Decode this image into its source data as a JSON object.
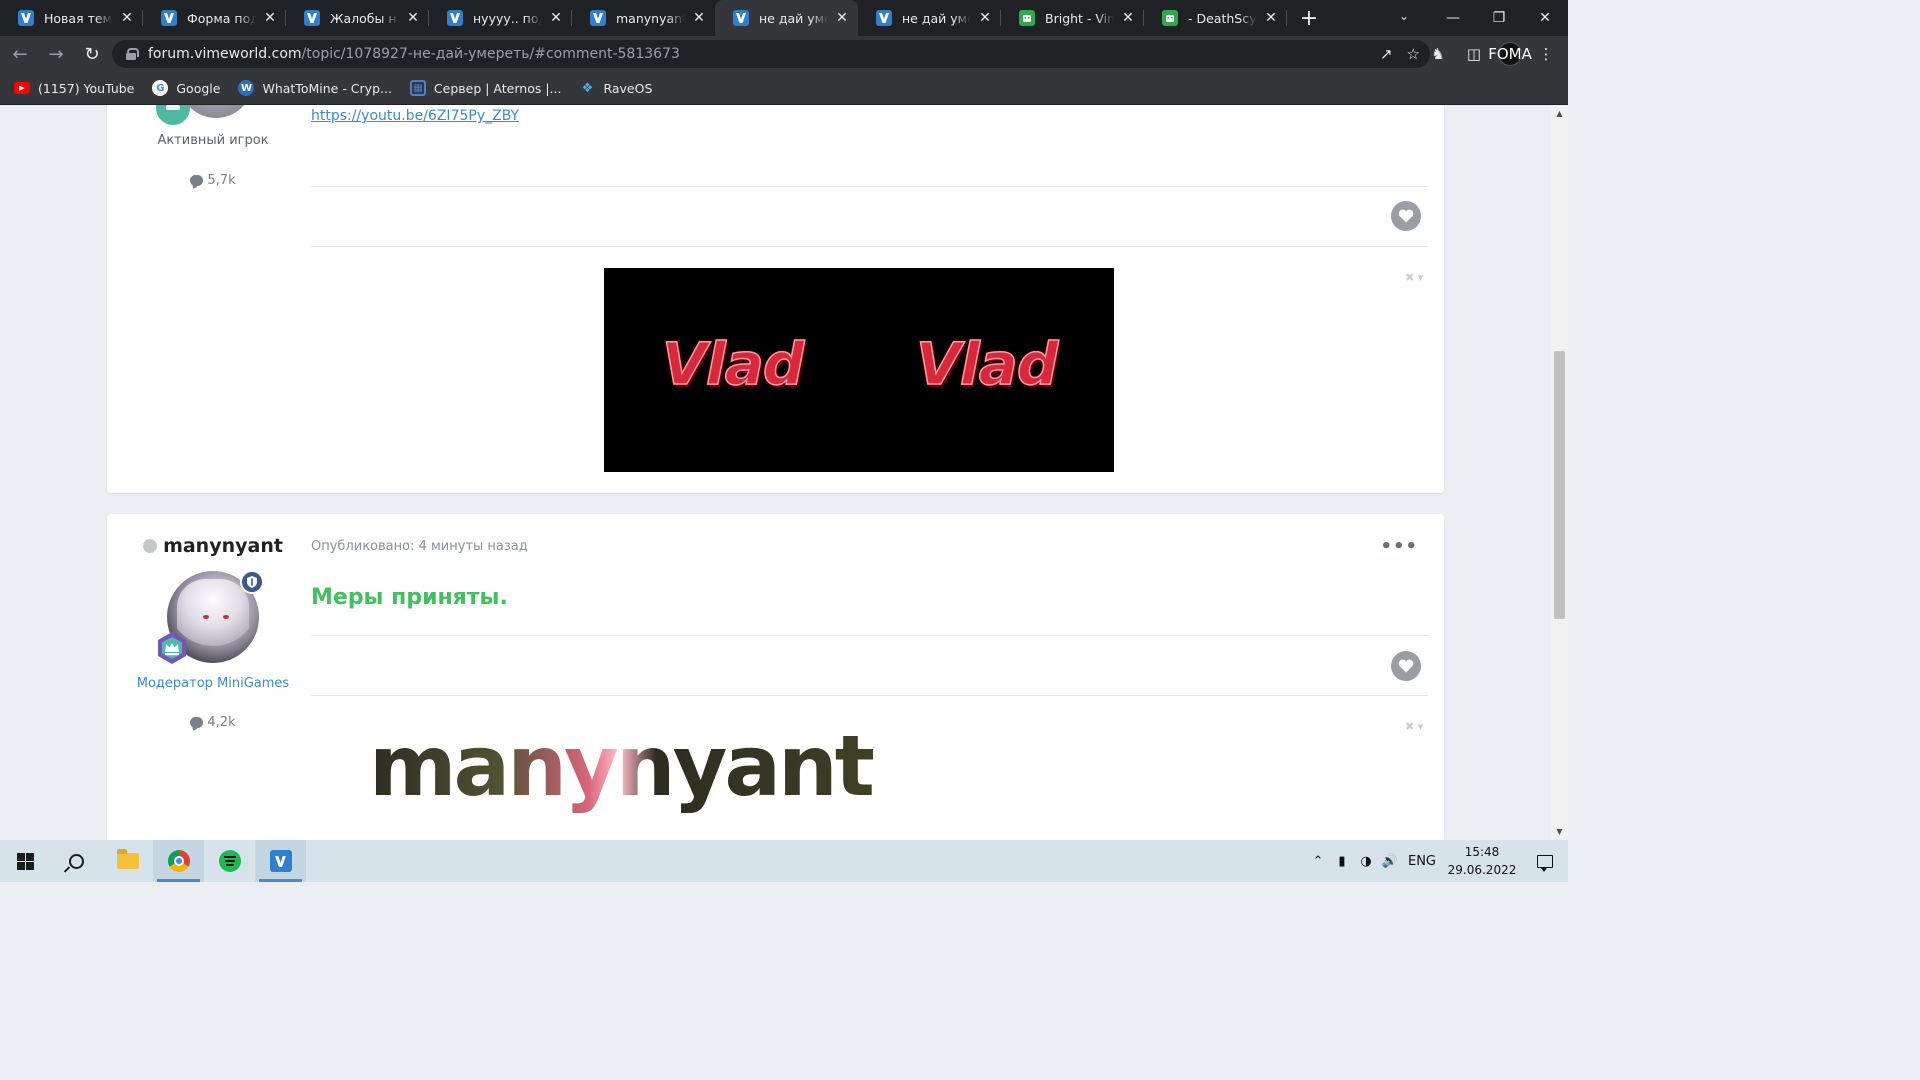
{
  "browser": {
    "tabs": [
      {
        "title": "Новая тема -",
        "favicon": "vime-icon",
        "active": false
      },
      {
        "title": "Форма подачи",
        "favicon": "vime-icon",
        "active": false
      },
      {
        "title": "Жалобы на п",
        "favicon": "vime-icon",
        "active": false
      },
      {
        "title": "нуууу.. подста",
        "favicon": "vime-icon",
        "active": false
      },
      {
        "title": "manynyant - V",
        "favicon": "vime-icon",
        "active": false
      },
      {
        "title": "не дай умере",
        "favicon": "vime-icon",
        "active": true
      },
      {
        "title": "не дай умере",
        "favicon": "vime-icon",
        "active": false
      },
      {
        "title": "Bright - Vime",
        "favicon": "green-face-icon",
        "active": false
      },
      {
        "title": "- DeathScythe",
        "favicon": "green-face-icon",
        "active": false
      }
    ],
    "url_host": "forum.vimeworld.com",
    "url_path": "/topic/1078927-не-дай-умереть/#comment-5813673",
    "profile_label": "FOMA",
    "bookmarks": [
      {
        "label": "(1157) YouTube",
        "icon": "youtube-icon"
      },
      {
        "label": "Google",
        "icon": "google-icon"
      },
      {
        "label": "WhatToMine - Cryp...",
        "icon": "whattomine-icon"
      },
      {
        "label": "Сервер | Aternos |...",
        "icon": "aternos-icon"
      },
      {
        "label": "RaveOS",
        "icon": "raveos-icon"
      }
    ]
  },
  "post1": {
    "rank": "Активный игрок",
    "posts_count": "5,7k",
    "link": "https://youtu.be/6ZI75Py_ZBY",
    "signature_words": [
      "Vlad",
      "Vlad"
    ]
  },
  "post2": {
    "author": "manynyant",
    "meta": "Опубликовано: 4 минуты назад",
    "body": "Меры приняты.",
    "rank": "Модератор MiniGames",
    "posts_count": "4,2k",
    "signature_text": "manynyant"
  },
  "taskbar": {
    "apps": [
      "windows-start-icon",
      "search-icon",
      "file-explorer-icon",
      "chrome-icon",
      "spotify-icon",
      "vimeworld-icon"
    ],
    "language": "ENG",
    "time": "15:48",
    "date": "29.06.2022"
  },
  "colors": {
    "accent_link": "#3a8bd1",
    "success_green": "#3fc15d",
    "chrome_dark": "#202124",
    "chrome_toolbar": "#35363a"
  }
}
